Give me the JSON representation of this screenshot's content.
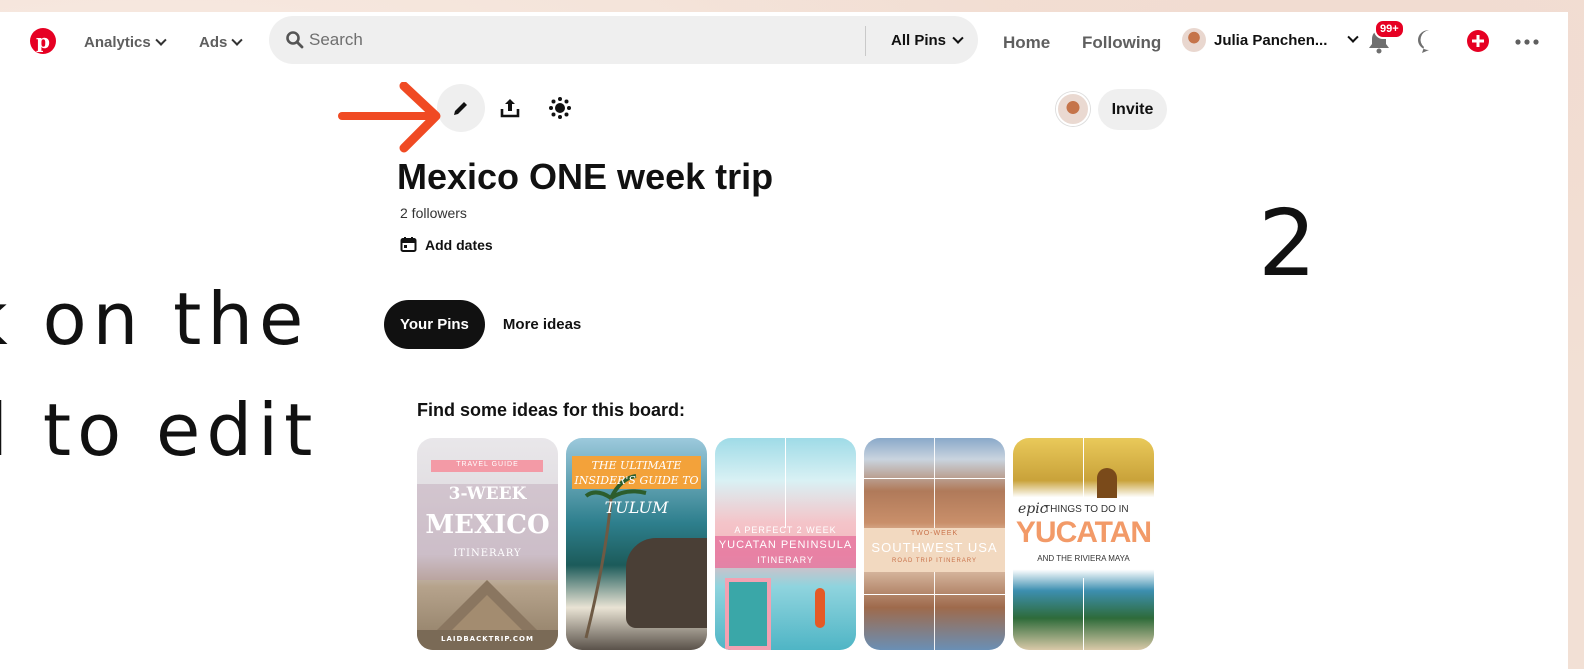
{
  "colors": {
    "brand": "#e60023",
    "arrow": "#f04a23"
  },
  "nav": {
    "analytics_label": "Analytics",
    "ads_label": "Ads",
    "search_placeholder": "Search",
    "filter_label": "All Pins",
    "home_label": "Home",
    "following_label": "Following",
    "user_name": "Julia Panchen...",
    "notifications_badge": "99+",
    "icons": [
      "pinterest-logo",
      "search-icon",
      "bell-icon",
      "chat-icon",
      "plus-icon",
      "more-icon"
    ]
  },
  "board_toolbar": {
    "icons": [
      "pencil-icon",
      "share-icon",
      "sparkle-icon"
    ],
    "invite_label": "Invite"
  },
  "board": {
    "title": "Mexico ONE week trip",
    "followers": "2 followers",
    "add_dates_label": "Add dates"
  },
  "tabs": [
    {
      "label": "Your Pins",
      "active": true
    },
    {
      "label": "More ideas",
      "active": false
    }
  ],
  "ideas": {
    "heading": "Find some ideas for this board:",
    "cards": [
      {
        "lines": [
          "TRAVEL GUIDE",
          "3-WEEK",
          "MEXICO",
          "ITINERARY",
          "LAIDBACKTRIP.COM"
        ]
      },
      {
        "lines": [
          "THE ULTIMATE",
          "INSIDER'S GUIDE TO",
          "TULUM"
        ]
      },
      {
        "lines": [
          "A PERFECT 2 WEEK",
          "YUCATAN PENINSULA",
          "ITINERARY"
        ]
      },
      {
        "lines": [
          "TWO-WEEK",
          "SOUTHWEST USA",
          "ROAD TRIP ITINERARY"
        ]
      },
      {
        "lines": [
          "epic",
          "THINGS TO DO IN",
          "YUCATAN",
          "AND THE RIVIERA MAYA"
        ]
      }
    ]
  },
  "overlay": {
    "line1": "on the",
    "line2": "l to edit",
    "step": "2"
  }
}
